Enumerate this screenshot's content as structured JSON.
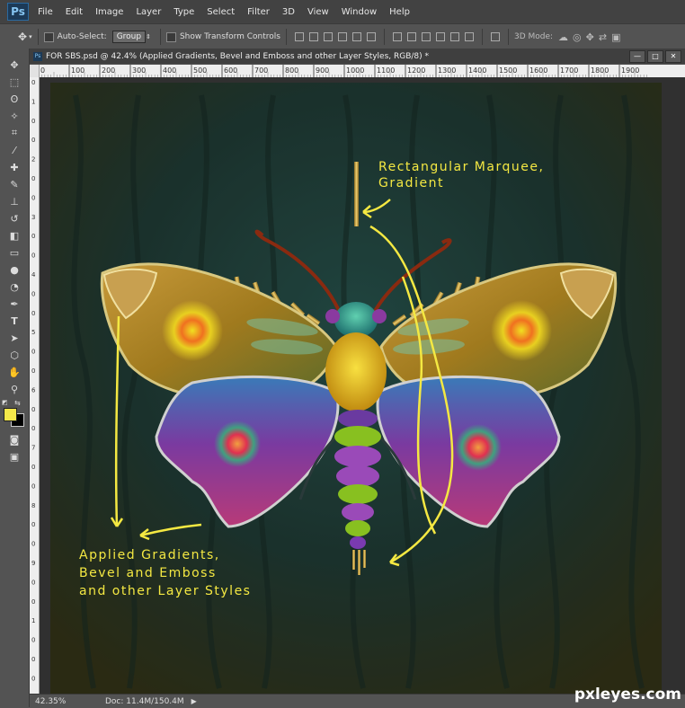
{
  "app": {
    "logo": "Ps"
  },
  "menu": [
    "File",
    "Edit",
    "Image",
    "Layer",
    "Type",
    "Select",
    "Filter",
    "3D",
    "View",
    "Window",
    "Help"
  ],
  "options": {
    "auto_select_label": "Auto-Select:",
    "auto_select_value": "Group",
    "show_transform_label": "Show Transform Controls",
    "mode_3d_label": "3D Mode:"
  },
  "document": {
    "tab_title": "FOR SBS.psd @ 42.4% (Applied Gradients, Bevel and Emboss and other Layer Styles, RGB/8) *"
  },
  "ruler": {
    "h_ticks": [
      "0",
      "100",
      "200",
      "300",
      "400",
      "500",
      "600",
      "700",
      "800",
      "900",
      "1000",
      "1100",
      "1200",
      "1300",
      "1400",
      "1500",
      "1600",
      "1700",
      "1800",
      "1900"
    ],
    "v_ticks": [
      "0",
      "1",
      "0",
      "0",
      "2",
      "0",
      "0",
      "3",
      "0",
      "0",
      "4",
      "0",
      "0",
      "5",
      "0",
      "0",
      "6",
      "0",
      "0",
      "7",
      "0",
      "0",
      "8",
      "0",
      "0",
      "9",
      "0",
      "0",
      "1",
      "0",
      "0",
      "0"
    ]
  },
  "annotations": {
    "top": [
      "Rectangular Marquee,",
      "Gradient"
    ],
    "bottom": [
      "Applied Gradients,",
      "Bevel and Emboss",
      "and other Layer Styles"
    ]
  },
  "colors": {
    "annotation": "#f4e842",
    "foreground": "#f4e84a",
    "background": "#000000"
  },
  "status": {
    "zoom": "42.35%",
    "doc_info": "Doc: 11.4M/150.4M"
  },
  "watermark": "pxleyes.com"
}
